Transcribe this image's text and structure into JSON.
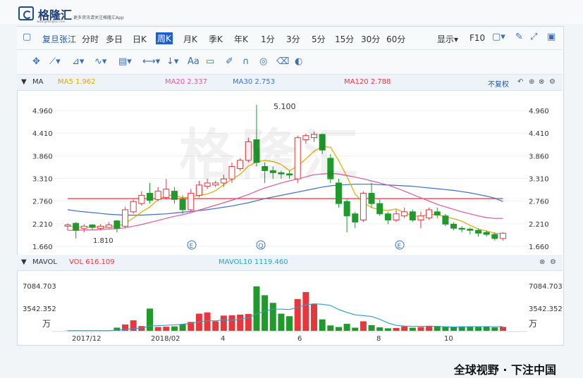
{
  "brand": {
    "name": "格隆汇",
    "subtitle": "更多资讯请关注格隆汇App",
    "url": "www.gelonghui.com"
  },
  "toolbar": {
    "stock_name": "复旦张江",
    "periods": [
      "分时",
      "多日",
      "日K",
      "周K",
      "月K",
      "季K",
      "年K",
      "1分",
      "3分",
      "5分",
      "15分",
      "30分",
      "60分"
    ],
    "active_period": "周K",
    "display_label": "显示▾",
    "f10_label": "F10"
  },
  "price_panel": {
    "label": "MA",
    "ma5": "MA5 1.962",
    "ma20": "MA20 2.337",
    "ma30": "MA30 2.753",
    "ma120": "MA120 2.788",
    "adjust": "不复权"
  },
  "volume_panel": {
    "label": "MAVOL",
    "vol": "VOL 616.109",
    "mavol10": "MAVOL10 1119.460"
  },
  "y_ticks_price": [
    "4.960",
    "4.410",
    "3.860",
    "3.310",
    "2.760",
    "2.210",
    "1.660"
  ],
  "y_ticks_volume": [
    "7084.703",
    "3542.352",
    "万"
  ],
  "x_ticks": [
    "2017/12",
    "2018/02",
    "4",
    "6",
    "8",
    "10"
  ],
  "annotations": {
    "high": "5.100",
    "low": "1.810"
  },
  "event_markers": [
    "E",
    "Q",
    "E"
  ],
  "colors": {
    "up": "#e8363d",
    "down": "#1f9a2b",
    "ma5": "#e0a800",
    "ma20": "#e0589a",
    "ma30": "#3a72c2",
    "ma120": "#e8363d",
    "mavol": "#2aa0c8"
  },
  "chart_data": {
    "type": "candlestick",
    "y_range": [
      1.66,
      4.96
    ],
    "volume_range": [
      0,
      7084.703
    ],
    "candles": [
      {
        "o": 2.15,
        "c": 2.18,
        "h": 2.22,
        "l": 2.05,
        "v": 30
      },
      {
        "o": 2.22,
        "c": 2.05,
        "h": 2.25,
        "l": 1.85,
        "v": 40
      },
      {
        "o": 2.1,
        "c": 2.15,
        "h": 2.2,
        "l": 2.0,
        "v": 30
      },
      {
        "o": 2.18,
        "c": 2.12,
        "h": 2.2,
        "l": 2.05,
        "v": 25
      },
      {
        "o": 2.1,
        "c": 2.15,
        "h": 2.2,
        "l": 2.05,
        "v": 30
      },
      {
        "o": 2.12,
        "c": 2.18,
        "h": 2.25,
        "l": 2.1,
        "v": 60
      },
      {
        "o": 2.28,
        "c": 2.1,
        "h": 2.3,
        "l": 2.0,
        "v": 500
      },
      {
        "o": 2.15,
        "c": 2.55,
        "h": 2.62,
        "l": 2.1,
        "v": 1000
      },
      {
        "o": 2.5,
        "c": 2.75,
        "h": 2.8,
        "l": 2.45,
        "v": 1650
      },
      {
        "o": 2.7,
        "c": 2.9,
        "h": 3.0,
        "l": 2.65,
        "v": 750
      },
      {
        "o": 2.95,
        "c": 2.78,
        "h": 3.2,
        "l": 2.7,
        "v": 3500
      },
      {
        "o": 2.8,
        "c": 3.0,
        "h": 3.1,
        "l": 2.75,
        "v": 600
      },
      {
        "o": 2.85,
        "c": 3.05,
        "h": 3.3,
        "l": 2.8,
        "v": 650
      },
      {
        "o": 3.0,
        "c": 2.8,
        "h": 3.1,
        "l": 2.7,
        "v": 700
      },
      {
        "o": 2.8,
        "c": 2.55,
        "h": 2.9,
        "l": 2.45,
        "v": 1050
      },
      {
        "o": 2.55,
        "c": 2.95,
        "h": 3.05,
        "l": 2.5,
        "v": 1400
      },
      {
        "o": 2.9,
        "c": 3.15,
        "h": 3.25,
        "l": 2.85,
        "v": 2700
      },
      {
        "o": 3.12,
        "c": 3.2,
        "h": 3.3,
        "l": 3.05,
        "v": 2900
      },
      {
        "o": 3.15,
        "c": 3.2,
        "h": 3.25,
        "l": 3.1,
        "v": 1500
      },
      {
        "o": 3.2,
        "c": 3.3,
        "h": 3.4,
        "l": 3.1,
        "v": 2400
      },
      {
        "o": 3.3,
        "c": 3.6,
        "h": 3.7,
        "l": 3.2,
        "v": 2450
      },
      {
        "o": 3.55,
        "c": 3.75,
        "h": 3.8,
        "l": 3.5,
        "v": 2550
      },
      {
        "o": 3.75,
        "c": 4.2,
        "h": 4.3,
        "l": 3.7,
        "v": 2650
      },
      {
        "o": 4.25,
        "c": 3.7,
        "h": 5.1,
        "l": 3.6,
        "v": 7000
      },
      {
        "o": 3.6,
        "c": 3.5,
        "h": 3.7,
        "l": 3.2,
        "v": 5600
      },
      {
        "o": 3.5,
        "c": 3.45,
        "h": 3.6,
        "l": 3.3,
        "v": 4400
      },
      {
        "o": 3.45,
        "c": 3.42,
        "h": 3.5,
        "l": 3.3,
        "v": 2700
      },
      {
        "o": 3.42,
        "c": 3.4,
        "h": 3.5,
        "l": 3.3,
        "v": 2300
      },
      {
        "o": 3.3,
        "c": 4.3,
        "h": 4.35,
        "l": 3.2,
        "v": 5000
      },
      {
        "o": 4.25,
        "c": 4.35,
        "h": 4.4,
        "l": 4.15,
        "v": 6100
      },
      {
        "o": 4.3,
        "c": 4.38,
        "h": 4.45,
        "l": 4.2,
        "v": 4200
      },
      {
        "o": 4.38,
        "c": 4.0,
        "h": 4.4,
        "l": 3.9,
        "v": 1800
      },
      {
        "o": 3.8,
        "c": 3.3,
        "h": 3.9,
        "l": 3.2,
        "v": 850
      },
      {
        "o": 3.2,
        "c": 2.7,
        "h": 3.3,
        "l": 2.6,
        "v": 600
      },
      {
        "o": 2.75,
        "c": 2.4,
        "h": 2.8,
        "l": 2.0,
        "v": 1100
      },
      {
        "o": 2.45,
        "c": 2.25,
        "h": 2.5,
        "l": 2.1,
        "v": 500
      },
      {
        "o": 2.3,
        "c": 2.95,
        "h": 3.0,
        "l": 2.25,
        "v": 1500
      },
      {
        "o": 2.95,
        "c": 2.7,
        "h": 3.2,
        "l": 2.6,
        "v": 900
      },
      {
        "o": 2.7,
        "c": 2.45,
        "h": 2.8,
        "l": 2.4,
        "v": 550
      },
      {
        "o": 2.45,
        "c": 2.3,
        "h": 2.5,
        "l": 2.2,
        "v": 400
      },
      {
        "o": 2.3,
        "c": 2.45,
        "h": 2.55,
        "l": 2.25,
        "v": 450
      },
      {
        "o": 2.4,
        "c": 2.5,
        "h": 2.6,
        "l": 2.35,
        "v": 700
      },
      {
        "o": 2.5,
        "c": 2.3,
        "h": 2.55,
        "l": 2.25,
        "v": 500
      },
      {
        "o": 2.3,
        "c": 2.4,
        "h": 2.5,
        "l": 2.1,
        "v": 600
      },
      {
        "o": 2.35,
        "c": 2.55,
        "h": 2.6,
        "l": 2.3,
        "v": 800
      },
      {
        "o": 2.5,
        "c": 2.42,
        "h": 2.6,
        "l": 2.35,
        "v": 750
      },
      {
        "o": 2.4,
        "c": 2.2,
        "h": 2.45,
        "l": 2.15,
        "v": 700
      },
      {
        "o": 2.2,
        "c": 2.1,
        "h": 2.25,
        "l": 2.05,
        "v": 650
      },
      {
        "o": 2.1,
        "c": 2.08,
        "h": 2.15,
        "l": 2.0,
        "v": 700
      },
      {
        "o": 2.08,
        "c": 2.05,
        "h": 2.12,
        "l": 1.95,
        "v": 650
      },
      {
        "o": 2.05,
        "c": 1.98,
        "h": 2.1,
        "l": 1.9,
        "v": 600
      },
      {
        "o": 2.0,
        "c": 1.95,
        "h": 2.05,
        "l": 1.9,
        "v": 650
      },
      {
        "o": 1.95,
        "c": 1.85,
        "h": 2.0,
        "l": 1.8,
        "v": 550
      },
      {
        "o": 1.85,
        "c": 1.98,
        "h": 2.0,
        "l": 1.8,
        "v": 616
      }
    ],
    "ma20": [
      2.05,
      2.05,
      2.06,
      2.06,
      2.07,
      2.08,
      2.09,
      2.11,
      2.15,
      2.19,
      2.24,
      2.29,
      2.34,
      2.39,
      2.43,
      2.48,
      2.54,
      2.6,
      2.66,
      2.72,
      2.78,
      2.85,
      2.92,
      3.0,
      3.08,
      3.14,
      3.2,
      3.25,
      3.3,
      3.35,
      3.4,
      3.42,
      3.43,
      3.42,
      3.38,
      3.34,
      3.3,
      3.25,
      3.2,
      3.15,
      3.08,
      3.0,
      2.92,
      2.84,
      2.76,
      2.68,
      2.62,
      2.56,
      2.5,
      2.45,
      2.4,
      2.36,
      2.34,
      2.34
    ],
    "ma30": [
      2.55,
      2.52,
      2.5,
      2.48,
      2.46,
      2.44,
      2.43,
      2.42,
      2.42,
      2.42,
      2.43,
      2.44,
      2.45,
      2.47,
      2.49,
      2.51,
      2.53,
      2.55,
      2.58,
      2.61,
      2.64,
      2.68,
      2.72,
      2.77,
      2.82,
      2.86,
      2.9,
      2.94,
      2.98,
      3.02,
      3.06,
      3.1,
      3.13,
      3.15,
      3.16,
      3.17,
      3.17,
      3.17,
      3.16,
      3.15,
      3.14,
      3.13,
      3.12,
      3.1,
      3.08,
      3.06,
      3.04,
      3.02,
      2.99,
      2.96,
      2.92,
      2.88,
      2.83,
      2.75
    ],
    "ma120": 2.82
  }
}
